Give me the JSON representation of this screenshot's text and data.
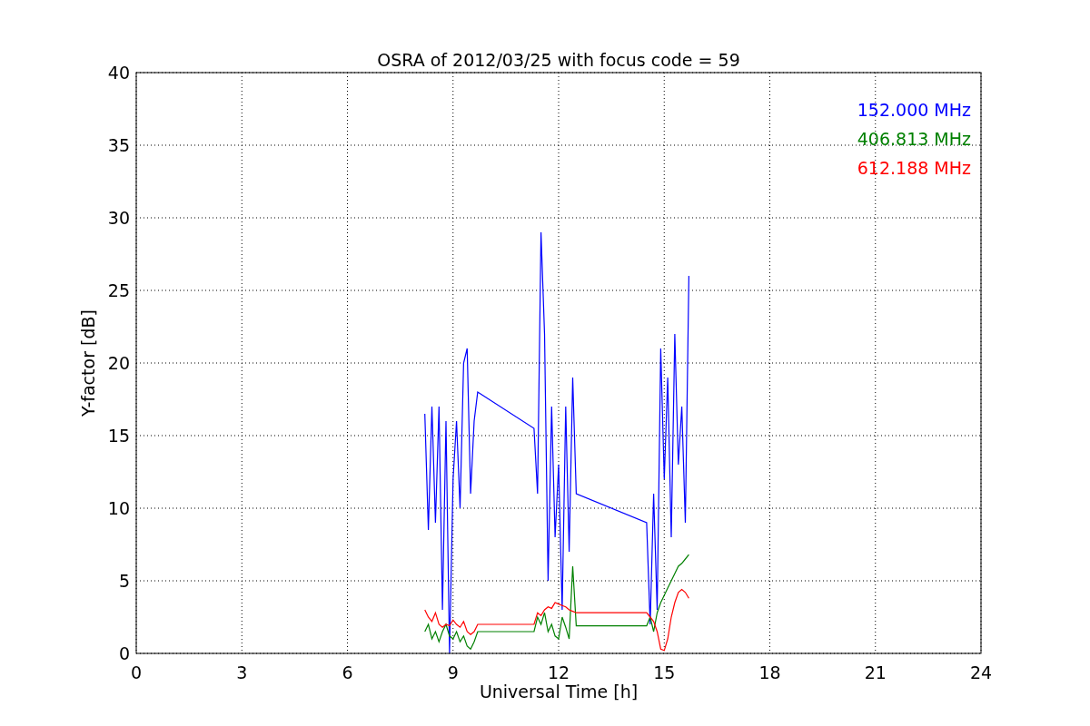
{
  "chart": {
    "chart_data": {
      "type": "line",
      "title": "OSRA of 2012/03/25 with focus code = 59",
      "xlabel": "Universal Time [h]",
      "ylabel": "Y-factor [dB]",
      "xlim": [
        0,
        24
      ],
      "ylim": [
        0,
        40
      ],
      "xticks": [
        0,
        3,
        6,
        9,
        12,
        15,
        18,
        21,
        24
      ],
      "yticks": [
        0,
        5,
        10,
        15,
        20,
        25,
        30,
        35,
        40
      ],
      "grid": true,
      "x": [
        8.2,
        8.3,
        8.4,
        8.5,
        8.6,
        8.7,
        8.8,
        8.9,
        9.0,
        9.1,
        9.2,
        9.3,
        9.4,
        9.5,
        9.6,
        9.7,
        11.3,
        11.4,
        11.5,
        11.6,
        11.7,
        11.8,
        11.9,
        12.0,
        12.1,
        12.2,
        12.3,
        12.4,
        12.5,
        14.5,
        14.6,
        14.7,
        14.8,
        14.9,
        15.0,
        15.1,
        15.2,
        15.3,
        15.4,
        15.5,
        15.6,
        15.7
      ],
      "series": [
        {
          "name": "152.000 MHz",
          "color": "#0000ff",
          "values": [
            16.5,
            8.5,
            17,
            9,
            17,
            3,
            16,
            0,
            12,
            16,
            10,
            20,
            21,
            11,
            16,
            18,
            15.5,
            11,
            29,
            22,
            5,
            17,
            8,
            13,
            3,
            17,
            7,
            19,
            11,
            9,
            2,
            11,
            3,
            21,
            12,
            19,
            8,
            22,
            13,
            17,
            9,
            26
          ]
        },
        {
          "name": "406.813 MHz",
          "color": "#008000",
          "values": [
            1.5,
            2,
            1,
            1.5,
            0.8,
            1.5,
            2,
            1.2,
            1,
            1.5,
            0.8,
            1.2,
            0.5,
            0.3,
            0.8,
            1.5,
            1.5,
            2.5,
            2,
            2.8,
            1.5,
            2,
            1.2,
            1,
            2.5,
            1.8,
            1,
            6,
            1.9,
            1.9,
            2.5,
            1.5,
            2.8,
            3.5,
            4,
            4.5,
            5,
            5.5,
            6,
            6.2,
            6.5,
            6.8
          ]
        },
        {
          "name": "612.188 MHz",
          "color": "#ff0000",
          "values": [
            3,
            2.5,
            2.2,
            2.8,
            2,
            1.8,
            2,
            1.9,
            2.3,
            2,
            1.8,
            2.2,
            1.5,
            1.3,
            1.5,
            2,
            2,
            2.8,
            2.6,
            3,
            3.2,
            3.1,
            3.5,
            3.4,
            3.3,
            3.2,
            3,
            2.9,
            2.8,
            2.8,
            2.5,
            2.2,
            1.5,
            0.3,
            0.2,
            1,
            2.5,
            3.5,
            4.2,
            4.4,
            4.2,
            3.8
          ]
        }
      ]
    }
  }
}
